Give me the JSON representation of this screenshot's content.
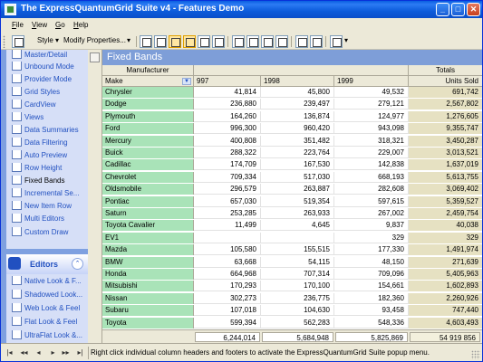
{
  "window": {
    "title": "The ExpressQuantumGrid Suite v4 - Features Demo"
  },
  "menu": [
    {
      "label": "File",
      "u": "F",
      "rest": "ile"
    },
    {
      "label": "View",
      "u": "V",
      "rest": "iew"
    },
    {
      "label": "Go",
      "u": "G",
      "rest": "o"
    },
    {
      "label": "Help",
      "u": "H",
      "rest": "elp"
    }
  ],
  "toolbar": {
    "style_label": "Style ▾",
    "modify_label": "Modify Properties...",
    "more_label": "▾"
  },
  "nav": {
    "items": [
      {
        "label": "Master/Detail",
        "icon": "master-detail-icon"
      },
      {
        "label": "Unbound Mode",
        "icon": "unbound-icon"
      },
      {
        "label": "Provider Mode",
        "icon": "provider-icon"
      },
      {
        "label": "Grid Styles",
        "icon": "styles-icon"
      },
      {
        "label": "CardView",
        "icon": "cardview-icon"
      },
      {
        "label": "Views",
        "icon": "views-icon"
      },
      {
        "label": "Data Summaries",
        "icon": "summaries-icon"
      },
      {
        "label": "Data Filtering",
        "icon": "filter-icon"
      },
      {
        "label": "Auto Preview",
        "icon": "preview-icon"
      },
      {
        "label": "Row Height",
        "icon": "row-height-icon"
      },
      {
        "label": "Fixed Bands",
        "icon": "bands-icon"
      },
      {
        "label": "Incremental Se...",
        "icon": "incremental-icon"
      },
      {
        "label": "New Item Row",
        "icon": "new-item-icon"
      },
      {
        "label": "Multi Editors",
        "icon": "multi-editors-icon"
      },
      {
        "label": "Custom Draw",
        "icon": "custom-draw-icon"
      }
    ],
    "editors_header": "Editors",
    "editors_items": [
      {
        "label": "Native Look & F...",
        "icon": "native-look-icon"
      },
      {
        "label": "Shadowed Look...",
        "icon": "shadowed-look-icon"
      },
      {
        "label": "Web Look & Feel",
        "icon": "web-look-icon"
      },
      {
        "label": "Flat Look & Feel",
        "icon": "flat-look-icon"
      },
      {
        "label": "UltraFlat Look &...",
        "icon": "ultraflat-look-icon"
      }
    ]
  },
  "grid": {
    "title": "Fixed Bands",
    "band_manufacturer": "Manufacturer",
    "band_totals": "Totals",
    "headers": {
      "make": "Make",
      "y1997": "997",
      "y1998": "1998",
      "y1999": "1999",
      "units": "Units Sold"
    },
    "rows": [
      {
        "make": "Chrysler",
        "y1997": "41,814",
        "y1998": "45,800",
        "y1999": "49,532",
        "units": "691,742"
      },
      {
        "make": "Dodge",
        "y1997": "236,880",
        "y1998": "239,497",
        "y1999": "279,121",
        "units": "2,567,802"
      },
      {
        "make": "Plymouth",
        "y1997": "164,260",
        "y1998": "136,874",
        "y1999": "124,977",
        "units": "1,276,605"
      },
      {
        "make": "Ford",
        "y1997": "996,300",
        "y1998": "960,420",
        "y1999": "943,098",
        "units": "9,355,747"
      },
      {
        "make": "Mercury",
        "y1997": "400,808",
        "y1998": "351,482",
        "y1999": "318,321",
        "units": "3,450,287"
      },
      {
        "make": "Buick",
        "y1997": "288,322",
        "y1998": "223,764",
        "y1999": "229,007",
        "units": "3,013,521"
      },
      {
        "make": "Cadillac",
        "y1997": "174,709",
        "y1998": "167,530",
        "y1999": "142,838",
        "units": "1,637,019"
      },
      {
        "make": "Chevrolet",
        "y1997": "709,334",
        "y1998": "517,030",
        "y1999": "668,193",
        "units": "5,613,755"
      },
      {
        "make": "Oldsmobile",
        "y1997": "296,579",
        "y1998": "263,887",
        "y1999": "282,608",
        "units": "3,069,402"
      },
      {
        "make": "Pontiac",
        "y1997": "657,030",
        "y1998": "519,354",
        "y1999": "597,615",
        "units": "5,359,527"
      },
      {
        "make": "Saturn",
        "y1997": "253,285",
        "y1998": "263,933",
        "y1999": "267,002",
        "units": "2,459,754"
      },
      {
        "make": "Toyota Cavalier",
        "y1997": "11,499",
        "y1998": "4,645",
        "y1999": "9,837",
        "units": "40,038"
      },
      {
        "make": "EV1",
        "y1997": "",
        "y1998": "",
        "y1999": "329",
        "units": "329"
      },
      {
        "make": "Mazda",
        "y1997": "105,580",
        "y1998": "155,515",
        "y1999": "177,330",
        "units": "1,491,974"
      },
      {
        "make": "BMW",
        "y1997": "63,668",
        "y1998": "54,115",
        "y1999": "48,150",
        "units": "271,639"
      },
      {
        "make": "Honda",
        "y1997": "664,968",
        "y1998": "707,314",
        "y1999": "709,096",
        "units": "5,405,963"
      },
      {
        "make": "Mitsubishi",
        "y1997": "170,293",
        "y1998": "170,100",
        "y1999": "154,661",
        "units": "1,602,893"
      },
      {
        "make": "Nissan",
        "y1997": "302,273",
        "y1998": "236,775",
        "y1999": "182,360",
        "units": "2,260,926"
      },
      {
        "make": "Subaru",
        "y1997": "107,018",
        "y1998": "104,630",
        "y1999": "93,458",
        "units": "747,440"
      },
      {
        "make": "Toyota",
        "y1997": "599,394",
        "y1998": "562,283",
        "y1999": "548,336",
        "units": "4,603,493"
      }
    ],
    "footer": {
      "y1997": "6,244,014",
      "y1998": "5,684,948",
      "y1999": "5,825,869",
      "units": "54 919 856"
    }
  },
  "status": {
    "text": "Right click individual column headers and footers to activate the ExpressQuantumGrid Suite popup menu."
  }
}
